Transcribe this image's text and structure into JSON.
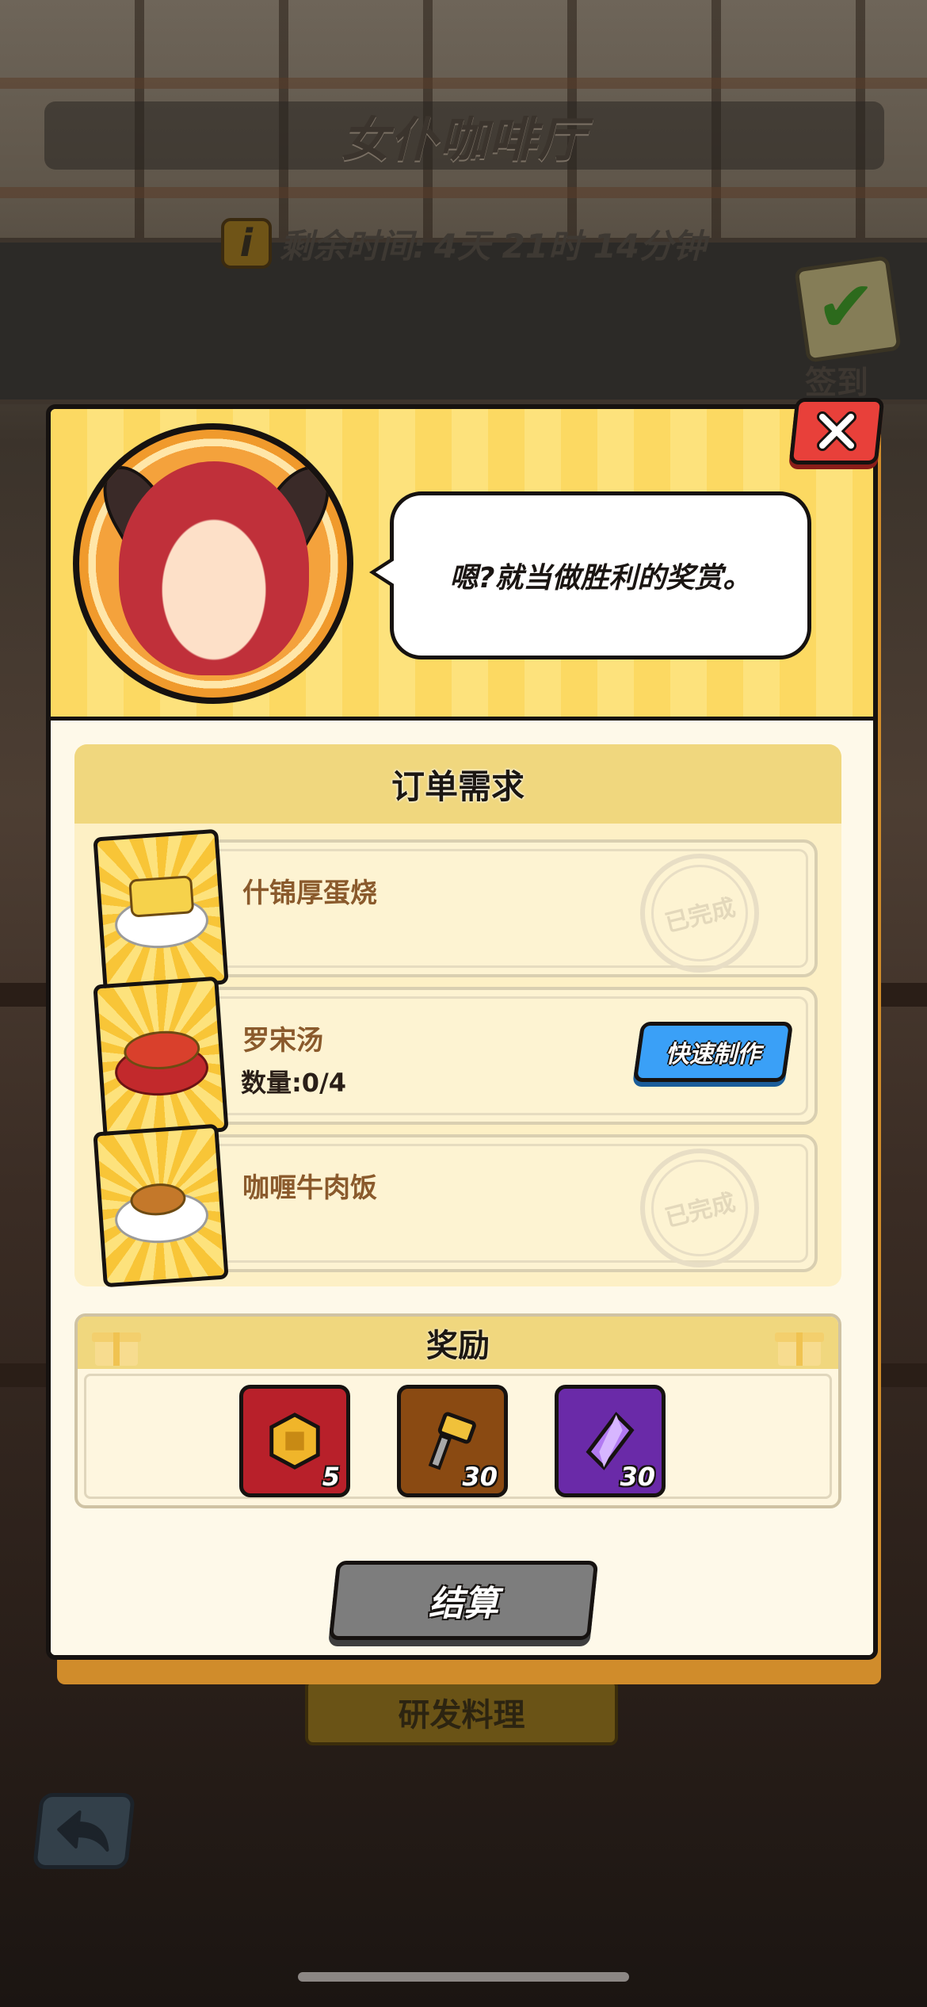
{
  "screen": {
    "title": "女仆咖啡厅",
    "timer_label": "剩余时间:",
    "timer_value": "4天 21时 14分钟",
    "info_icon_text": "i",
    "signin_label": "签到",
    "research_label": "研发料理"
  },
  "dialog": {
    "speech": "嗯?就当做胜利的奖赏。",
    "order_title": "订单需求",
    "orders": [
      {
        "name": "什锦厚蛋烧",
        "status": "已完成",
        "icon": "tamagoyaki-icon"
      },
      {
        "name": "罗宋汤",
        "quantity_label": "数量:0/4",
        "action": "快速制作",
        "icon": "borscht-icon"
      },
      {
        "name": "咖喱牛肉饭",
        "status": "已完成",
        "icon": "curry-rice-icon"
      }
    ],
    "reward_title": "奖励",
    "rewards": [
      {
        "icon": "gold-token-icon",
        "count": "5",
        "color": "#b8202a"
      },
      {
        "icon": "hammer-icon",
        "count": "30",
        "color": "#8a4a12"
      },
      {
        "icon": "purple-crystal-icon",
        "count": "30",
        "color": "#6a2aa8"
      }
    ],
    "settle_label": "结算"
  },
  "colors": {
    "accent_yellow": "#fcd962",
    "quick_button_blue": "#3aa0f7",
    "close_red": "#e8403a",
    "settle_gray": "#7d7d7d"
  }
}
